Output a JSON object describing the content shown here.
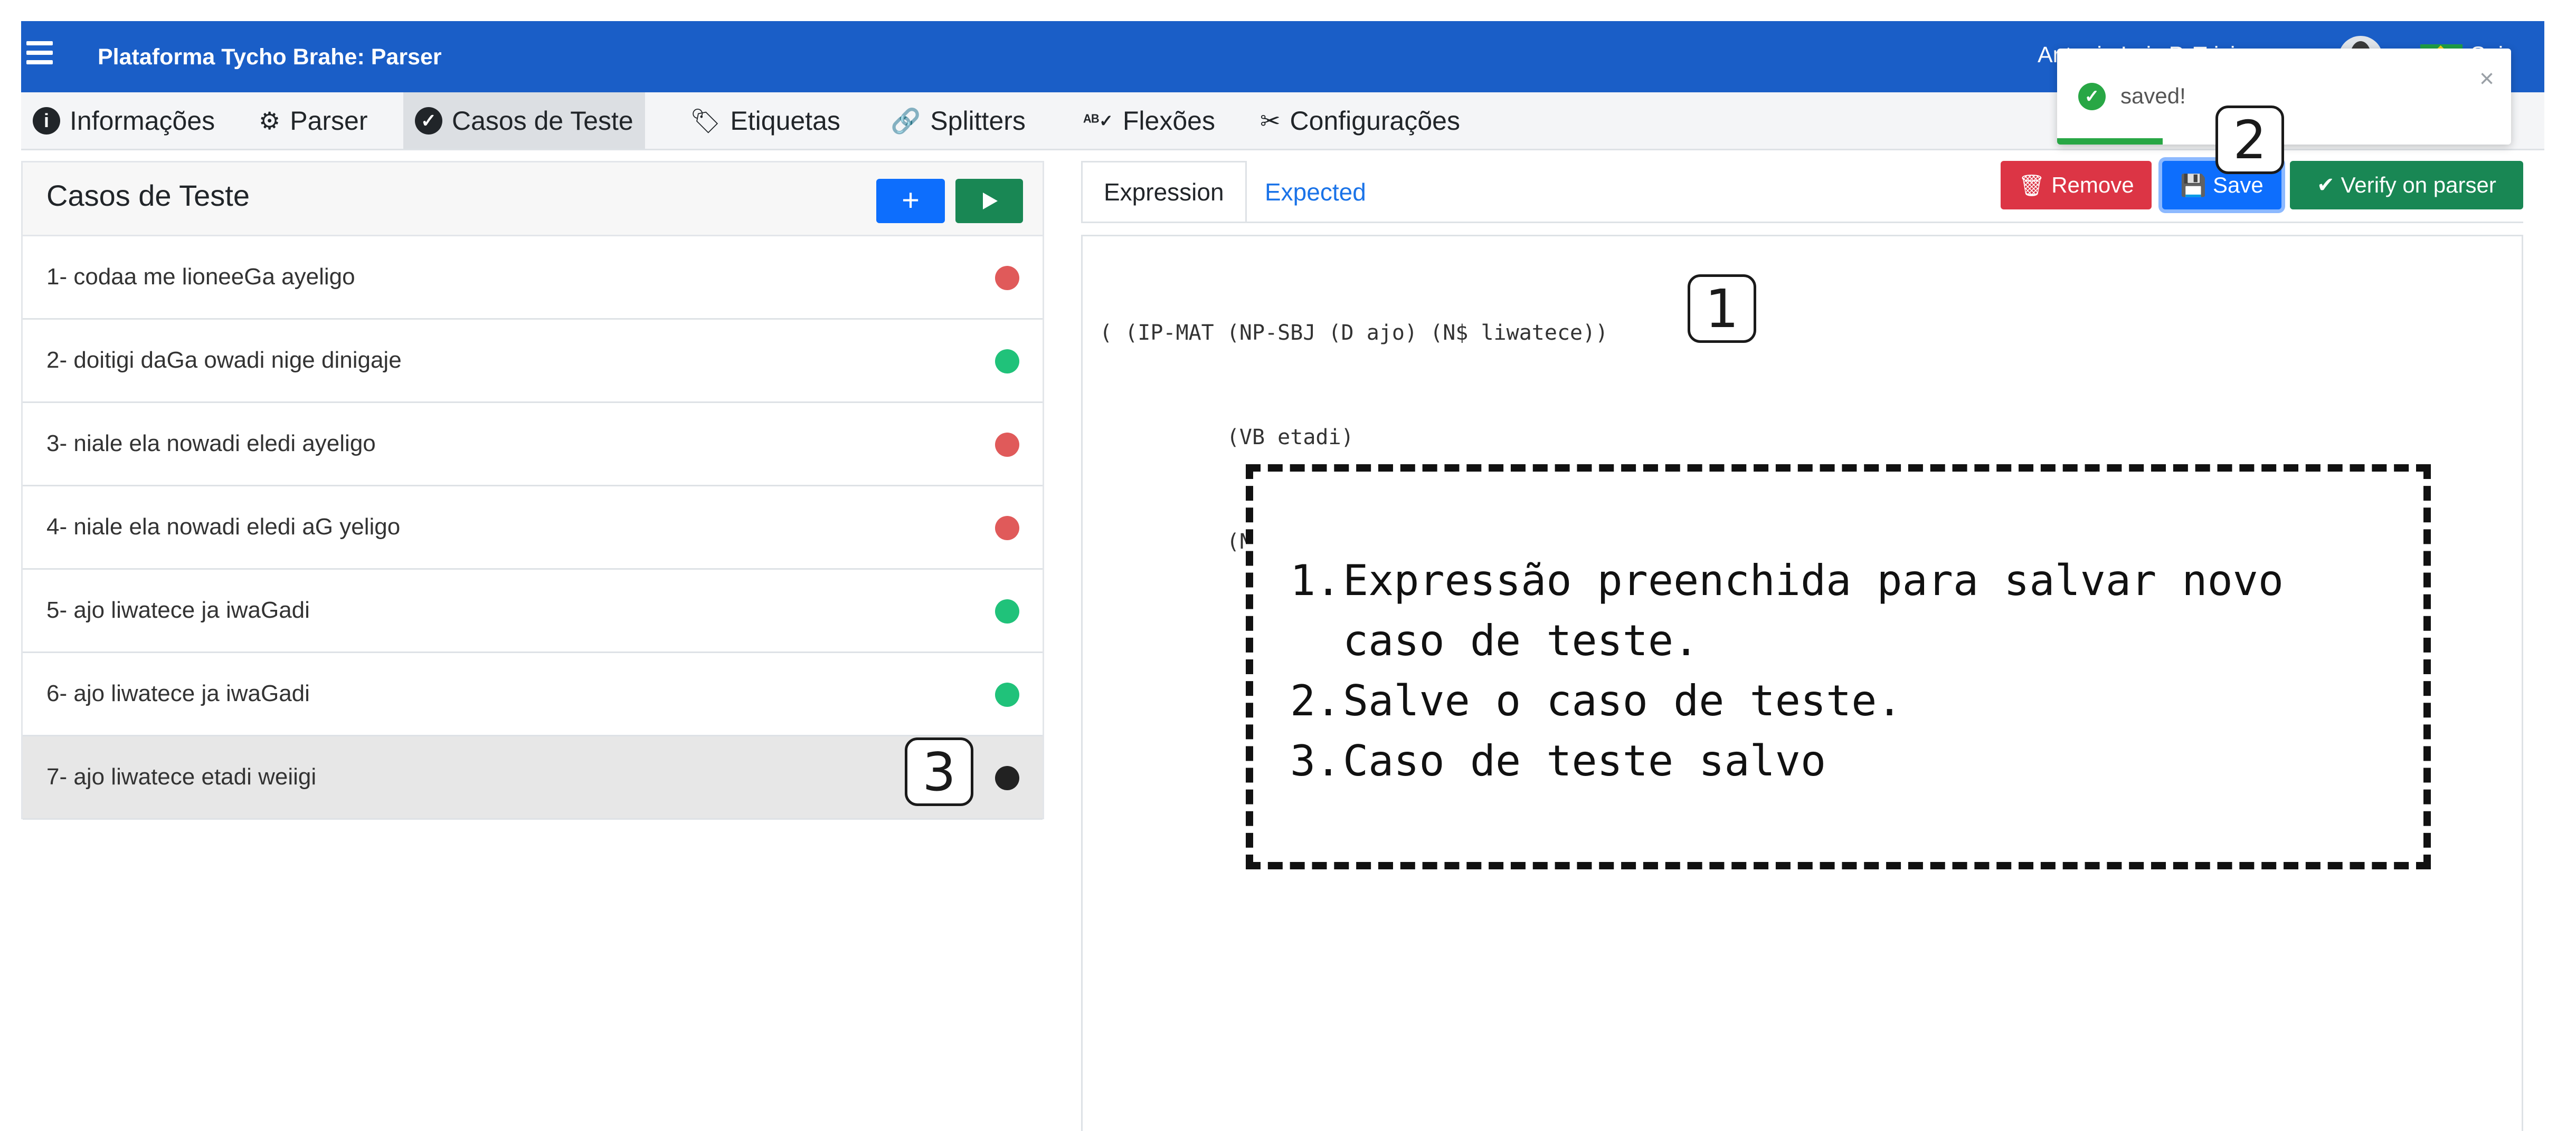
{
  "topbar": {
    "title": "Plataforma Tycho Brahe: Parser",
    "user_name": "Antonio Luis P. Trizia",
    "logout_label": "Sair"
  },
  "nav": {
    "items": [
      {
        "label": "Informações",
        "icon": "info-icon"
      },
      {
        "label": "Parser",
        "icon": "gears-icon"
      },
      {
        "label": "Casos de Teste",
        "icon": "check-circle-icon"
      },
      {
        "label": "Etiquetas",
        "icon": "tags-icon"
      },
      {
        "label": "Splitters",
        "icon": "link-icon"
      },
      {
        "label": "Flexões",
        "icon": "spell-check-icon"
      },
      {
        "label": "Configurações",
        "icon": "tools-icon"
      }
    ],
    "active_index": 2
  },
  "cases_panel": {
    "title": "Casos de Teste",
    "add_label": "+",
    "items": [
      {
        "label": "1- codaa me lioneeGa ayeligo",
        "status": "fail"
      },
      {
        "label": "2- doitigi daGa owadi nige dinigaje",
        "status": "pass"
      },
      {
        "label": "3- niale ela nowadi eledi ayeligo",
        "status": "fail"
      },
      {
        "label": "4- niale ela nowadi eledi aG yeligo",
        "status": "fail"
      },
      {
        "label": "5- ajo liwatece ja iwaGadi",
        "status": "pass"
      },
      {
        "label": "6- ajo liwatece ja iwaGadi",
        "status": "pass"
      },
      {
        "label": "7- ajo liwatece etadi weiigi",
        "status": "untested"
      }
    ],
    "selected_index": 6
  },
  "status_colors": {
    "fail": "#e05a5a",
    "pass": "#20c27a",
    "untested": "#222222"
  },
  "editor": {
    "tabs": [
      "Expression",
      "Expected"
    ],
    "active_tab": "Expression",
    "remove_label": "Remove",
    "save_label": "Save",
    "verify_label": "Verify on parser",
    "code_lines": [
      "( (IP-MAT (NP-SBJ (D ajo) (N$ liwatece))",
      "          (VB etadi)",
      "          (NP-ACC (N weiigi))))"
    ]
  },
  "toast": {
    "message": "saved!",
    "close": "×"
  },
  "annotations": {
    "callout_1": "1",
    "callout_2": "2",
    "callout_3": "3",
    "notes": [
      {
        "num": "1.",
        "text": "Expressão preenchida para salvar novo caso de teste."
      },
      {
        "num": "2.",
        "text": "Salve o caso de teste."
      },
      {
        "num": "3.",
        "text": "Caso de teste salvo"
      }
    ]
  }
}
